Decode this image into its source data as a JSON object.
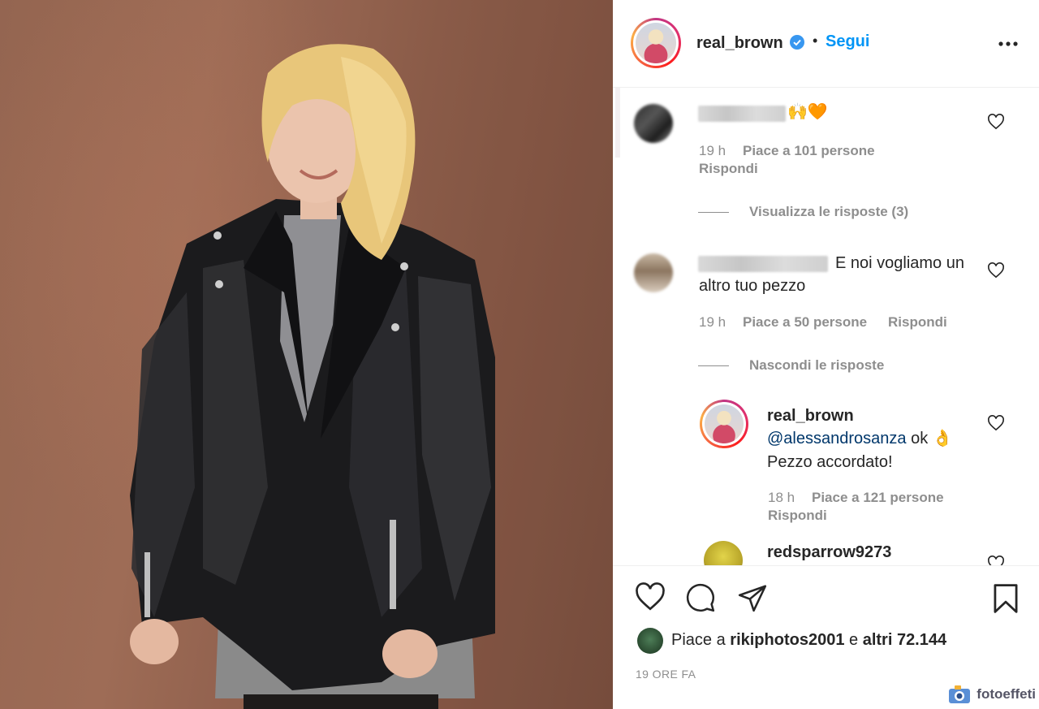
{
  "post": {
    "username": "real_brown",
    "follow_label": "Segui",
    "separator": "•"
  },
  "comments": [
    {
      "emoji": "🙌🧡",
      "time": "19 h",
      "likes": "Piace a 101 persone",
      "reply_label": "Rispondi",
      "view_replies": "Visualizza le risposte (3)"
    },
    {
      "text": "E noi vogliamo un altro tuo pezzo",
      "time": "19 h",
      "likes": "Piace a 50 persone",
      "reply_label": "Rispondi",
      "hide_replies": "Nascondi le risposte",
      "reply": {
        "username": "real_brown",
        "mention": "@alessandrosanza",
        "text_after_mention": "ok 👌",
        "text_line2": "Pezzo accordato!",
        "time": "18 h",
        "likes": "Piace a 121 persone",
        "reply_label": "Rispondi"
      }
    },
    {
      "username": "redsparrow9273"
    }
  ],
  "actions": {
    "like_icon": "heart-icon",
    "comment_icon": "comment-icon",
    "share_icon": "paper-plane-icon",
    "save_icon": "bookmark-icon"
  },
  "likes_summary": {
    "prefix": "Piace a",
    "user": "rikiphotos2001",
    "connector": "e",
    "others": "altri 72.144"
  },
  "time_ago": "19 ORE FA",
  "watermark": "fotoeffeti",
  "colors": {
    "accent": "#0095f6",
    "text": "#262626",
    "muted": "#8e8e8e",
    "mention": "#00376b"
  }
}
